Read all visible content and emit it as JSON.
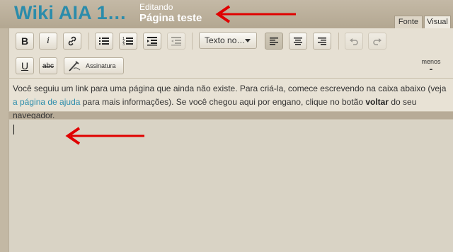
{
  "header": {
    "wiki_name": "Wiki AIA 1…",
    "editing_label": "Editando",
    "page_title": "Página teste"
  },
  "tabs": {
    "source": "Fonte",
    "visual": "Visual"
  },
  "toolbar": {
    "bold": "B",
    "italic": "i",
    "format_select": "Texto no…",
    "underline": "U",
    "strikethrough": "abc",
    "signature": "Assinatura",
    "less": "menos",
    "less_symbol": "-"
  },
  "notice": {
    "text_before_link": "Você seguiu um link para uma página que ainda não existe. Para criá-la, comece escrevendo na caixa abaixo (veja ",
    "link_text": "a página de ajuda",
    "text_after_link": " para mais informações). Se você chegou aqui por engano, clique no botão ",
    "bold_text": "voltar",
    "text_end": " do seu navegador."
  },
  "colors": {
    "accent": "#2b8cab",
    "arrow": "#e00000",
    "chrome": "#b7ab97",
    "toolbar_bg": "#e6e0d3",
    "editor_bg": "#d9d3c5"
  },
  "icons": [
    "link-icon",
    "bullet-list-icon",
    "numbered-list-icon",
    "indent-icon",
    "outdent-icon",
    "align-left-icon",
    "align-center-icon",
    "align-right-icon",
    "undo-icon",
    "redo-icon",
    "signature-pen-icon",
    "red-arrow-icon"
  ]
}
